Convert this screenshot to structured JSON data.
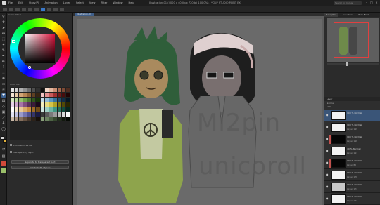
{
  "menubar": {
    "items": [
      "File",
      "Edit",
      "Story(P)",
      "Animation",
      "Layer",
      "Select",
      "View",
      "Filter",
      "Window",
      "Help"
    ],
    "title": "Illustration-01 (4000 x 4000px 720dpi 100.0%) - *CLIP STUDIO PAINT EX",
    "search_placeholder": "Search in menus"
  },
  "left_panel": {
    "color_tab": "Color Wheel",
    "palette_tab": "Color Set",
    "palette": [
      "#e6e6e6",
      "#cfcfcf",
      "#b0b0b0",
      "#909090",
      "#6e6e6e",
      "#4e4e4e",
      "#303030",
      "#111111",
      "#f1d6c8",
      "#e4b7a0",
      "#c98e74",
      "#a8694e",
      "#7d4a36",
      "#4e2c20",
      "#f4e4d4",
      "#e8caa8",
      "#d2a576",
      "#b78554",
      "#8f6236",
      "#5f3f22",
      "#362412",
      "#f2c4c4",
      "#e28f8f",
      "#c85a5a",
      "#a03030",
      "#701818",
      "#480c0c",
      "#200404",
      "#d6e8c0",
      "#b8d69a",
      "#96c070",
      "#6f9e48",
      "#4d7a2e",
      "#30561a",
      "#183508",
      "#c4dbe8",
      "#93bcd6",
      "#5f97bc",
      "#36709a",
      "#1f4c70",
      "#0f2d48",
      "#051624",
      "#e6d0e6",
      "#caa2ca",
      "#a774a7",
      "#804e80",
      "#5a305a",
      "#3a1a3a",
      "#1c0a1c",
      "#f4eec0",
      "#e8dc82",
      "#d4c44a",
      "#b0a024",
      "#807410",
      "#524a06",
      "#2a2602",
      "#ffffff",
      "#f3e3c9",
      "#e7c99a",
      "#d9ab6a",
      "#c88c3e",
      "#9e6a26",
      "#704a16",
      "#cfe6e0",
      "#9fd0c4",
      "#6fb6a4",
      "#3f9680",
      "#24705c",
      "#124c3c",
      "#062820",
      "#e2e2f2",
      "#c0c0e0",
      "#9a9aca",
      "#7474b0",
      "#525290",
      "#34346a",
      "#1a1a44",
      "#3a3a3a",
      "#5a5a5a",
      "#7a7a7a",
      "#9a9a9a",
      "#bababa",
      "#dadada",
      "#fafafa",
      "#c9b8a6",
      "#a89280",
      "#86705e",
      "#665242",
      "#48382c",
      "#2e2218",
      "#18100a",
      "#8aa07a",
      "#6b8260",
      "#4e6446",
      "#36482e",
      "#22301c",
      "#12190e",
      "#060a04"
    ],
    "subtool_label": "Enclosed Area Fill",
    "checkbox_label": "Transparency layers",
    "button1": "Separate to transparent part",
    "button2": "Delete both objects"
  },
  "canvas": {
    "tab_label": "Illustration-01",
    "watermark_line1": "Mi2pin",
    "watermark_line2": "unicoroll"
  },
  "right_panel": {
    "tabs": [
      "Navigator",
      "Sub View",
      "Item Bank"
    ],
    "layer_header": "Layer",
    "blend_mode": "Normal",
    "opacity": "100",
    "layers": [
      {
        "name": "100 % Normal",
        "mode": "",
        "thumb": "white",
        "selected": true,
        "marked": false
      },
      {
        "name": "100 % Normal",
        "mode": "Layer 199",
        "thumb": "white",
        "selected": false,
        "marked": false
      },
      {
        "name": "100 % Normal",
        "mode": "Layer 198",
        "thumb": "dark",
        "selected": false,
        "marked": true
      },
      {
        "name": "40 % Normal",
        "mode": "Layer 197",
        "thumb": "white",
        "selected": false,
        "marked": false
      },
      {
        "name": "100 % Normal",
        "mode": "Layer 80",
        "thumb": "dark",
        "selected": false,
        "marked": true
      },
      {
        "name": "100 % Normal",
        "mode": "Layer 176",
        "thumb": "white",
        "selected": false,
        "marked": false
      },
      {
        "name": "100 % Normal",
        "mode": "Layer 174",
        "thumb": "gray",
        "selected": false,
        "marked": false
      },
      {
        "name": "100 % Normal",
        "mode": "Layer 172",
        "thumb": "white",
        "selected": false,
        "marked": false
      }
    ]
  },
  "colors": {
    "accent": "#3a78c8",
    "selected_layer": "#3a5578",
    "canvas_bg": "#5e5e5e"
  }
}
